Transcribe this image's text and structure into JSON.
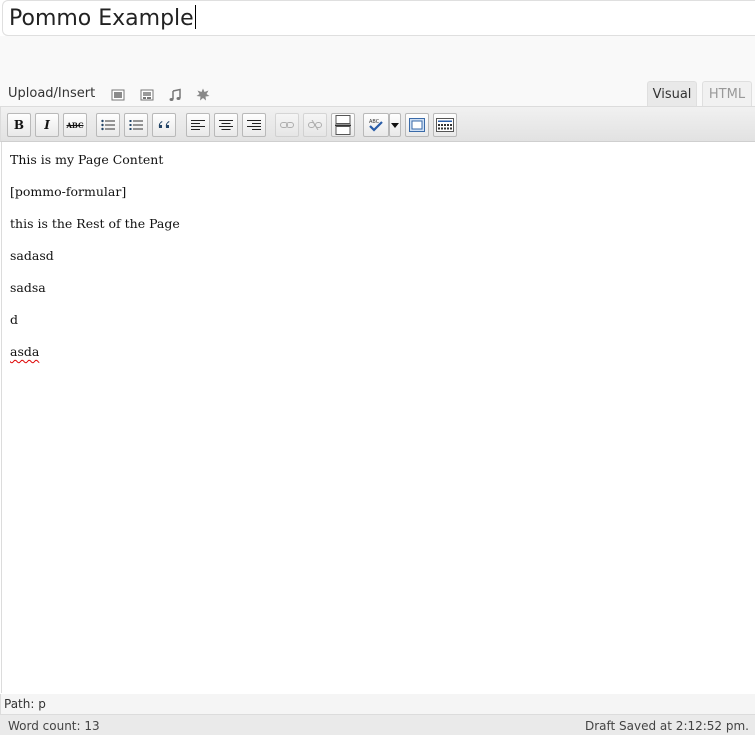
{
  "title": {
    "value": "Pommo Example"
  },
  "media": {
    "label": "Upload/Insert",
    "icons": [
      "image-icon",
      "gallery-icon",
      "audio-icon",
      "media-icon"
    ]
  },
  "tabs": {
    "visual": "Visual",
    "html": "HTML"
  },
  "toolbar": {
    "buttons": [
      "bold",
      "italic",
      "strikethrough",
      "bullet-list",
      "numbered-list",
      "blockquote",
      "align-left",
      "align-center",
      "align-right",
      "link",
      "unlink",
      "more-tag",
      "spellcheck",
      "spellcheck-dropdown",
      "fullscreen",
      "kitchen-sink"
    ],
    "bold_glyph": "B",
    "italic_glyph": "I",
    "strike_glyph": "ABC"
  },
  "content": {
    "paragraphs": [
      "This is my Page Content",
      "[pommo-formular]",
      "this is the Rest of the Page",
      "sadasd",
      "sadsa",
      "d",
      "asda"
    ]
  },
  "path": {
    "text": "Path: p"
  },
  "status": {
    "word_count": "Word count: 13",
    "draft_saved": "Draft Saved at 2:12:52 pm."
  }
}
